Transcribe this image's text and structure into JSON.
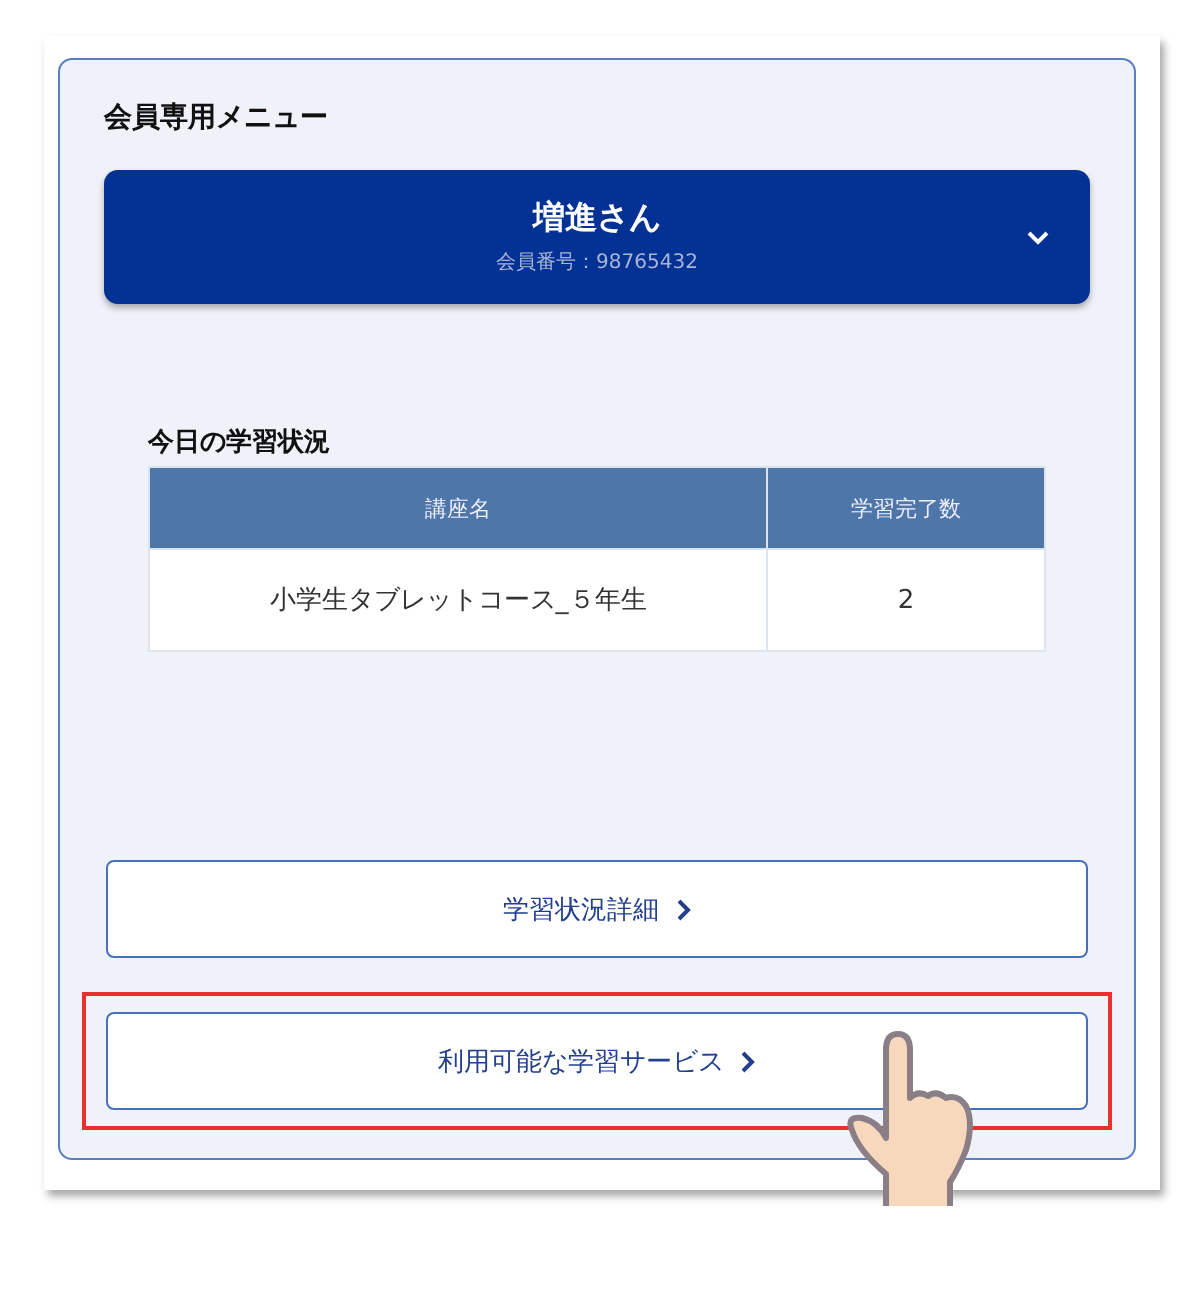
{
  "menu_title": "会員専用メニュー",
  "member": {
    "name": "増進さん",
    "number": "会員番号：98765432",
    "expanded": false
  },
  "status": {
    "heading": "今日の学習状況",
    "table": {
      "columns": [
        "講座名",
        "学習完了数"
      ],
      "rows": [
        [
          "小学生タブレットコース_５年生",
          "2"
        ]
      ]
    }
  },
  "buttons": [
    {
      "label": "学習状況詳細",
      "highlighted": false
    },
    {
      "label": "利用可能な学習サービス",
      "highlighted": true
    }
  ]
}
